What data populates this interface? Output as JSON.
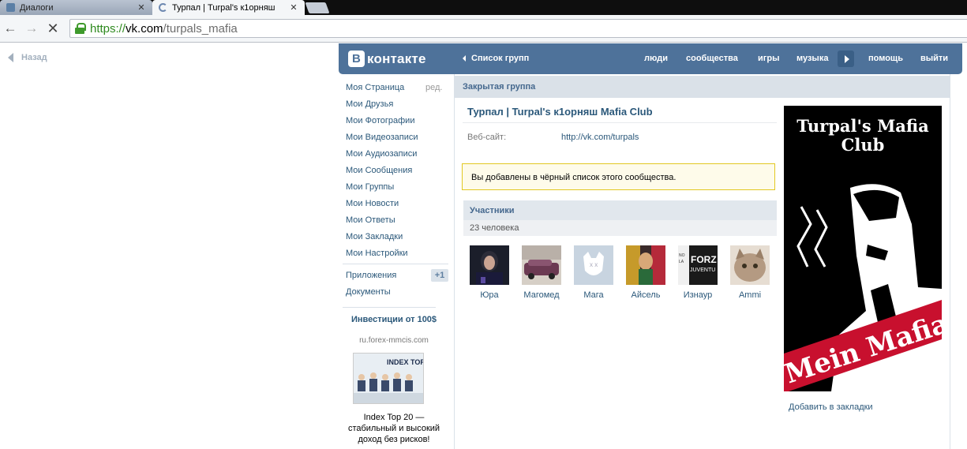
{
  "browser": {
    "tabs": [
      {
        "title": "Диалоги",
        "active": false
      },
      {
        "title": "Турпал | Turpal's к1орняш",
        "active": true
      }
    ],
    "url": {
      "scheme": "https://",
      "host": "vk.com",
      "path": "/turpals_mafia"
    }
  },
  "page": {
    "back_label": "Назад",
    "logo_text": "контакте",
    "logo_letter": "В",
    "group_list_label": "Список групп",
    "top_nav": [
      "люди",
      "сообщества",
      "игры",
      "музыка",
      "помощь",
      "выйти"
    ],
    "left_menu": [
      "Моя Страница",
      "Мои Друзья",
      "Мои Фотографии",
      "Мои Видеозаписи",
      "Мои Аудиозаписи",
      "Мои Сообщения",
      "Мои Группы",
      "Мои Новости",
      "Мои Ответы",
      "Мои Закладки",
      "Мои Настройки"
    ],
    "edit_label": "ред.",
    "apps_label": "Приложения",
    "apps_badge": "+1",
    "docs_label": "Документы",
    "ad": {
      "title": "Инвестиции от 100$",
      "domain": "ru.forex-mmcis.com",
      "image_text": "INDEX TOP 20",
      "text": "Index Top 20 — стабильный и высокий доход без рисков!"
    },
    "closed_group_label": "Закрытая группа",
    "group_title": "Турпал | Turpal's к1орняш Mafia Club",
    "website_label": "Веб-сайт:",
    "website_value": "http://vk.com/turpals",
    "notice": "Вы добавлены в чёрный список этого сообщества.",
    "members_title": "Участники",
    "members_count": "23 человека",
    "members": [
      {
        "name": "Юра",
        "pic": "dark-portrait"
      },
      {
        "name": "Магомед",
        "pic": "car"
      },
      {
        "name": "Мага",
        "pic": "default-dog"
      },
      {
        "name": "Айсель",
        "pic": "colorful"
      },
      {
        "name": "Изнаур",
        "pic": "forza-juventus"
      },
      {
        "name": "Ammi",
        "pic": "cat"
      }
    ],
    "poster_title": "Turpal's Mafia Club",
    "poster_banner": "Mein Mafia",
    "bookmark_label": "Добавить в закладки"
  }
}
